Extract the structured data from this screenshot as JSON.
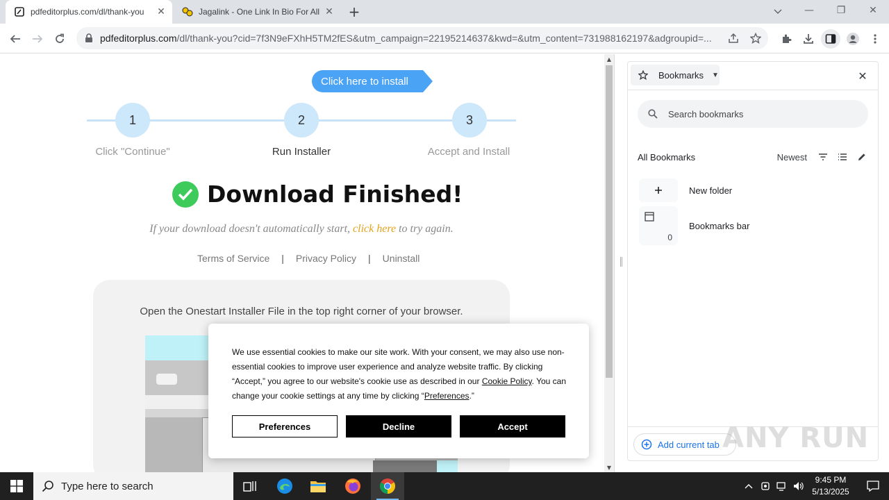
{
  "browser": {
    "tabs": [
      {
        "title": "pdfeditorplus.com/dl/thank-you",
        "active": true
      },
      {
        "title": "Jagalink - One Link In Bio For All",
        "active": false
      }
    ],
    "url_host": "pdfeditorplus.com",
    "url_path": "/dl/thank-you?cid=7f3N9eFXhH5TM2fES&utm_campaign=22195214637&kwd=&utm_content=731988162197&adgroupid=..."
  },
  "page": {
    "install_button": "Click here to install",
    "steps": [
      {
        "number": "1",
        "label": "Click \"Continue\""
      },
      {
        "number": "2",
        "label": "Run Installer"
      },
      {
        "number": "3",
        "label": "Accept and Install"
      }
    ],
    "title": "Download Finished!",
    "retry_prefix": "If your download doesn't automatically start, ",
    "retry_link": "click here",
    "retry_suffix": " to try again.",
    "links": [
      "Terms of Service",
      "Privacy Policy",
      "Uninstall"
    ],
    "separator": "|",
    "instruction": "Open the Onestart Installer File in the top right corner of your browser."
  },
  "cookie": {
    "text_1": "We use essential cookies to make our site work. With your consent, we may also use non-essential cookies to improve user experience and analyze website traffic. By clicking “Accept,” you agree to our website's cookie use as described in our ",
    "policy_link": "Cookie Policy",
    "text_2": ". You can change your cookie settings at any time by clicking “",
    "preferences_link": "Preferences",
    "text_3": ".”",
    "buttons": {
      "preferences": "Preferences",
      "decline": "Decline",
      "accept": "Accept"
    }
  },
  "side_panel": {
    "title": "Bookmarks",
    "search_placeholder": "Search bookmarks",
    "all_bookmarks": "All Bookmarks",
    "sort": "Newest",
    "new_folder": "New folder",
    "bookmarks_bar": "Bookmarks bar",
    "bookmarks_bar_count": "0",
    "add_current_tab": "Add current tab"
  },
  "watermark": "ANY RUN",
  "taskbar": {
    "search_placeholder": "Type here to search",
    "time": "9:45 PM",
    "date": "5/13/2025"
  }
}
